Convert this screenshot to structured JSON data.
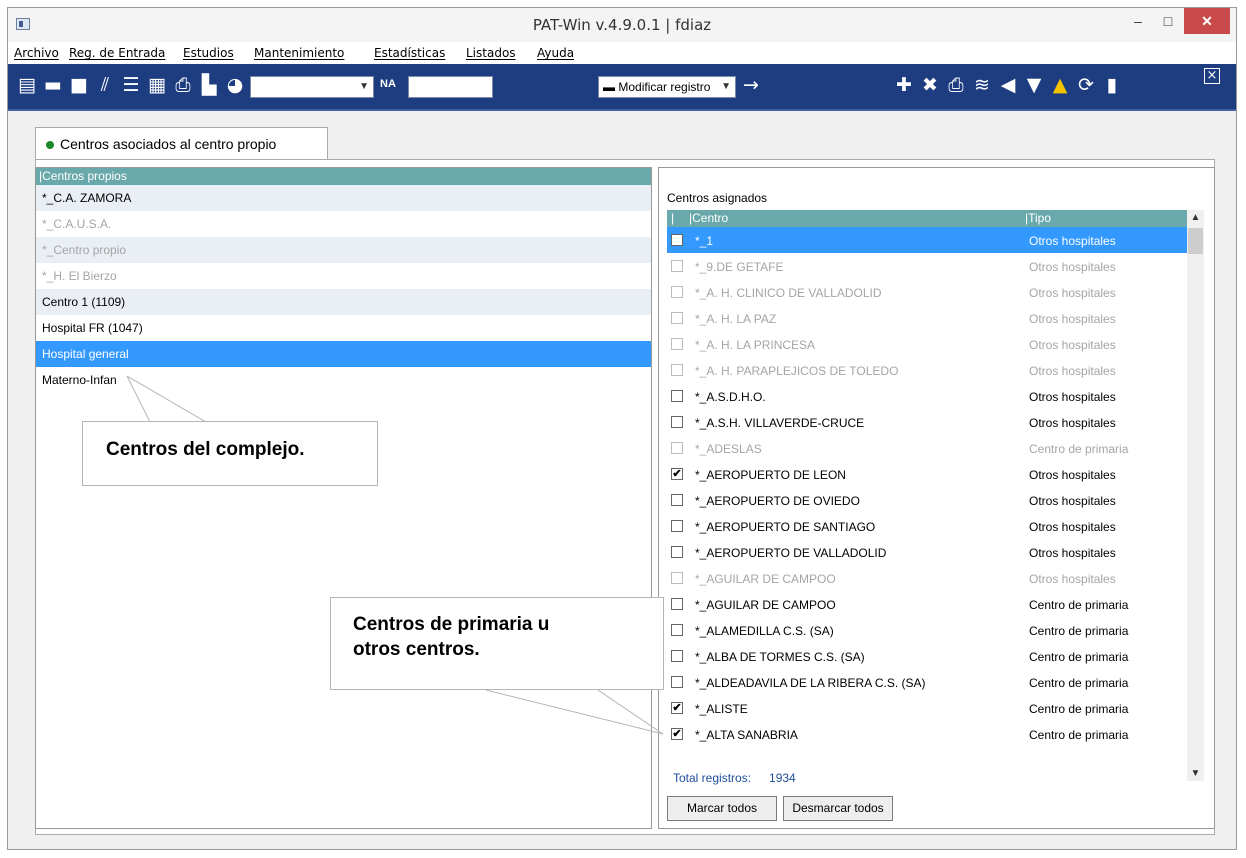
{
  "window": {
    "title": "PAT-Win v.4.9.0.1 | fdiaz",
    "minimize": "–",
    "maximize": "□",
    "close": "✕"
  },
  "menu": [
    "Archivo",
    "Reg. de Entrada",
    "Estudios",
    "Mantenimiento",
    "Estadísticas",
    "Listados",
    "Ayuda"
  ],
  "toolbar": {
    "na_label": "NA",
    "action_select": "Modificar registro",
    "left_icons": [
      "form-icon",
      "form-alt-icon",
      "book-icon",
      "pages-icon",
      "list-icon",
      "report-icon",
      "print-icon",
      "document-icon",
      "pie-chart-icon"
    ],
    "right_icons": [
      "add-icon",
      "delete-icon",
      "print-icon",
      "stack-icon",
      "speaker-icon",
      "comment-icon",
      "bell-icon",
      "refresh-icon",
      "lock-icon"
    ]
  },
  "tab": {
    "label": "Centros asociados al centro propio"
  },
  "left": {
    "header": "|Centros propios",
    "rows": [
      {
        "label": "*_C.A. ZAMORA"
      },
      {
        "label": "*_C.A.U.S.A."
      },
      {
        "label": "*_Centro propio"
      },
      {
        "label": "*_H. El Bierzo"
      },
      {
        "label": "Centro 1 (1109)"
      },
      {
        "label": "Hospital FR (1047)"
      },
      {
        "label": "Hospital general"
      },
      {
        "label": "Materno-Infan"
      }
    ]
  },
  "right": {
    "caption": "Centros asignados",
    "col_check": "|",
    "col_centro": "|Centro",
    "col_tipo": "|Tipo",
    "rows": [
      {
        "centro": "*_1",
        "tipo": "Otros hospitales",
        "checked": ""
      },
      {
        "centro": "*_9.DE GETAFE",
        "tipo": "Otros hospitales",
        "checked": ""
      },
      {
        "centro": "*_A. H. CLINICO DE VALLADOLID",
        "tipo": "Otros hospitales",
        "checked": ""
      },
      {
        "centro": "*_A. H. LA PAZ",
        "tipo": "Otros hospitales",
        "checked": ""
      },
      {
        "centro": "*_A. H. LA PRINCESA",
        "tipo": "Otros hospitales",
        "checked": ""
      },
      {
        "centro": "*_A. H. PARAPLEJICOS DE TOLEDO",
        "tipo": "Otros hospitales",
        "checked": ""
      },
      {
        "centro": "*_A.S.D.H.O.",
        "tipo": "Otros hospitales",
        "checked": ""
      },
      {
        "centro": "*_A.S.H. VILLAVERDE-CRUCE",
        "tipo": "Otros hospitales",
        "checked": ""
      },
      {
        "centro": "*_ADESLAS",
        "tipo": "Centro de primaria",
        "checked": ""
      },
      {
        "centro": "*_AEROPUERTO DE LEON",
        "tipo": "Otros hospitales",
        "checked": "✔"
      },
      {
        "centro": "*_AEROPUERTO DE OVIEDO",
        "tipo": "Otros hospitales",
        "checked": ""
      },
      {
        "centro": "*_AEROPUERTO DE SANTIAGO",
        "tipo": "Otros hospitales",
        "checked": ""
      },
      {
        "centro": "*_AEROPUERTO DE VALLADOLID",
        "tipo": "Otros hospitales",
        "checked": ""
      },
      {
        "centro": "*_AGUILAR DE CAMPOO",
        "tipo": "Otros hospitales",
        "checked": ""
      },
      {
        "centro": "*_AGUILAR DE CAMPOO",
        "tipo": "Centro de primaria",
        "checked": ""
      },
      {
        "centro": "*_ALAMEDILLA C.S. (SA)",
        "tipo": "Centro de primaria",
        "checked": ""
      },
      {
        "centro": "*_ALBA DE TORMES C.S. (SA)",
        "tipo": "Centro de primaria",
        "checked": ""
      },
      {
        "centro": "*_ALDEADAVILA DE LA RIBERA C.S. (SA)",
        "tipo": "Centro de primaria",
        "checked": ""
      },
      {
        "centro": "*_ALISTE",
        "tipo": "Centro de primaria",
        "checked": "✔"
      },
      {
        "centro": "*_ALTA SANABRIA",
        "tipo": "Centro de primaria",
        "checked": "✔"
      }
    ],
    "total_label": "Total registros:",
    "total_value": "1934",
    "btn_mark": "Marcar todos",
    "btn_unmark": "Desmarcar todos"
  },
  "callouts": {
    "complejo": "Centros del complejo.",
    "primaria_line1": "Centros de primaria u",
    "primaria_line2": "otros centros."
  }
}
